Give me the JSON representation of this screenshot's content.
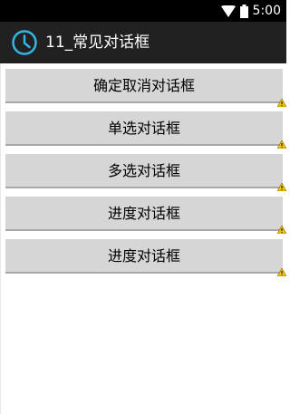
{
  "status_bar": {
    "time": "5:00",
    "icons": [
      "wifi-icon",
      "battery-icon"
    ]
  },
  "action_bar": {
    "icon": "clock-icon",
    "title": "11_常见对话框",
    "icon_color": "#33b5e5"
  },
  "buttons": [
    {
      "label": "确定取消对话框"
    },
    {
      "label": "单选对话框"
    },
    {
      "label": "多选对话框"
    },
    {
      "label": "进度对话框"
    },
    {
      "label": "进度对话框"
    }
  ],
  "warning_icon": "warning-icon",
  "colors": {
    "button_bg": "#d6d6d6",
    "action_bar_bg": "#212121",
    "status_bar_bg": "#000000",
    "warning": "#f2c200"
  }
}
